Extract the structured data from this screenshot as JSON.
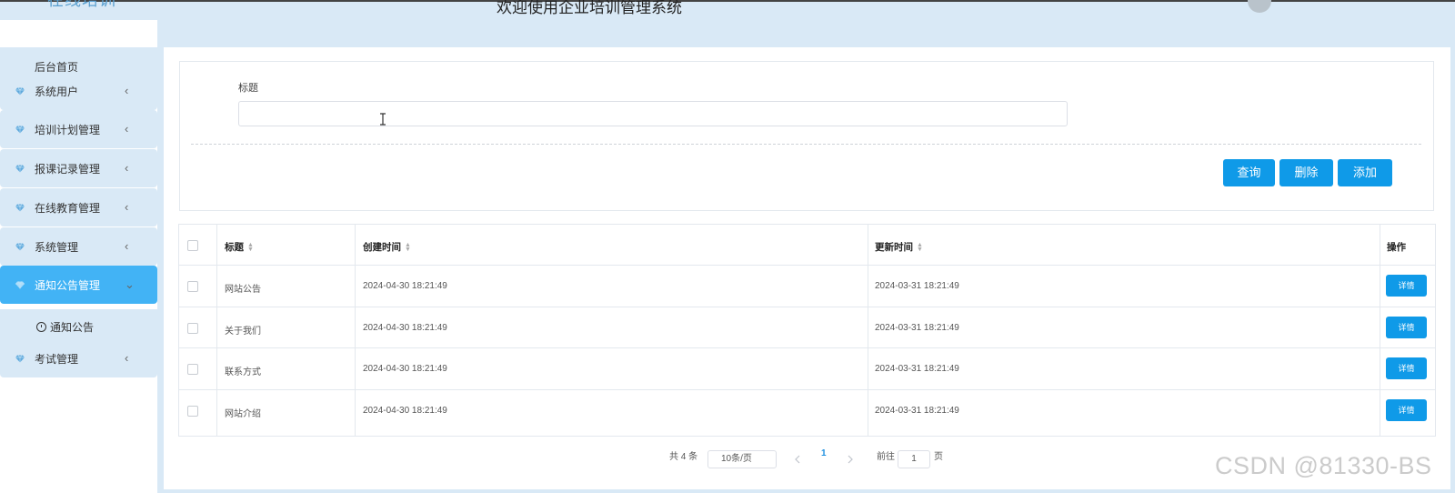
{
  "header": {
    "logo_text": "在线培训",
    "title": "欢迎使用企业培训管理系统"
  },
  "sidebar": {
    "home": "后台首页",
    "items": [
      {
        "label": "系统用户"
      },
      {
        "label": "培训计划管理"
      },
      {
        "label": "报课记录管理"
      },
      {
        "label": "在线教育管理"
      },
      {
        "label": "系统管理"
      },
      {
        "label": "通知公告管理"
      },
      {
        "label": "考试管理"
      }
    ],
    "sub_item": "通知公告"
  },
  "search": {
    "label": "标题",
    "value": "",
    "buttons": {
      "query": "查询",
      "delete": "删除",
      "add": "添加"
    }
  },
  "table": {
    "headers": {
      "title": "标题",
      "created": "创建时间",
      "updated": "更新时间",
      "action": "操作"
    },
    "rows": [
      {
        "title": "网站公告",
        "created": "2024-04-30 18:21:49",
        "updated": "2024-03-31 18:21:49",
        "action": "详情"
      },
      {
        "title": "关于我们",
        "created": "2024-04-30 18:21:49",
        "updated": "2024-03-31 18:21:49",
        "action": "详情"
      },
      {
        "title": "联系方式",
        "created": "2024-04-30 18:21:49",
        "updated": "2024-03-31 18:21:49",
        "action": "详情"
      },
      {
        "title": "网站介绍",
        "created": "2024-04-30 18:21:49",
        "updated": "2024-03-31 18:21:49",
        "action": "详情"
      }
    ]
  },
  "pagination": {
    "total": "共 4 条",
    "page_size": "10条/页",
    "current_page": "1",
    "goto_prefix": "前往",
    "goto_value": "1",
    "goto_suffix": "页",
    "prev_icon": "chevron-left",
    "next_icon": "chevron-right"
  },
  "watermark": "CSDN @81330-BS",
  "colors": {
    "primary": "#0f9ae8",
    "active_nav": "#42b3f5",
    "background": "#d9e9f6"
  }
}
